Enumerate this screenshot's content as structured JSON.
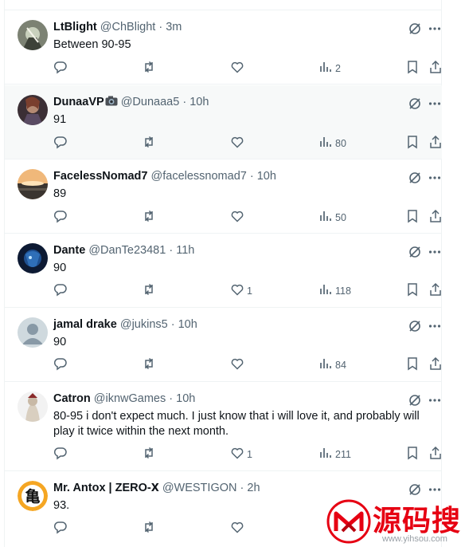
{
  "replies": [
    {
      "name": "LtBlight",
      "name_suffix": "",
      "handle": "@ChBlight",
      "time": "3m",
      "text": "Between 90-95",
      "reply_count": "",
      "retweet_count": "",
      "like_count": "",
      "views": "2",
      "highlighted": false
    },
    {
      "name": "DunaaVP",
      "name_suffix": "",
      "handle": "@Dunaaa5",
      "time": "10h",
      "text": "91",
      "reply_count": "",
      "retweet_count": "",
      "like_count": "",
      "views": "80",
      "highlighted": true
    },
    {
      "name": "FacelessNomad7",
      "name_suffix": "",
      "handle": "@facelessnomad7",
      "time": "10h",
      "text": "89",
      "reply_count": "",
      "retweet_count": "",
      "like_count": "",
      "views": "50",
      "highlighted": false
    },
    {
      "name": "Dante",
      "name_suffix": "",
      "handle": "@DanTe23481",
      "time": "11h",
      "text": "90",
      "reply_count": "",
      "retweet_count": "",
      "like_count": "1",
      "views": "118",
      "highlighted": false
    },
    {
      "name": "jamal drake",
      "name_suffix": "",
      "handle": "@jukins5",
      "time": "10h",
      "text": "90",
      "reply_count": "",
      "retweet_count": "",
      "like_count": "",
      "views": "84",
      "highlighted": false
    },
    {
      "name": "Catron",
      "name_suffix": "",
      "handle": "@iknwGames",
      "time": "10h",
      "text": "80-95 i don't expect much. I just know that i will love it, and probably will play it twice within the next month.",
      "reply_count": "",
      "retweet_count": "",
      "like_count": "1",
      "views": "211",
      "highlighted": false
    },
    {
      "name": "Mr. Antox | ZERO-",
      "name_suffix": "X",
      "handle": "@WESTIGON",
      "time": "2h",
      "text": "93.",
      "reply_count": "",
      "retweet_count": "",
      "like_count": "",
      "views": "",
      "highlighted": false
    }
  ],
  "separator": "·",
  "watermark": {
    "text": "源码搜",
    "url": "www.yihsou.com"
  },
  "colors": {
    "secondary_text": "#536471",
    "divider": "#eff3f4",
    "highlight_bg": "#f7f9f9",
    "watermark_red": "#e60012"
  }
}
